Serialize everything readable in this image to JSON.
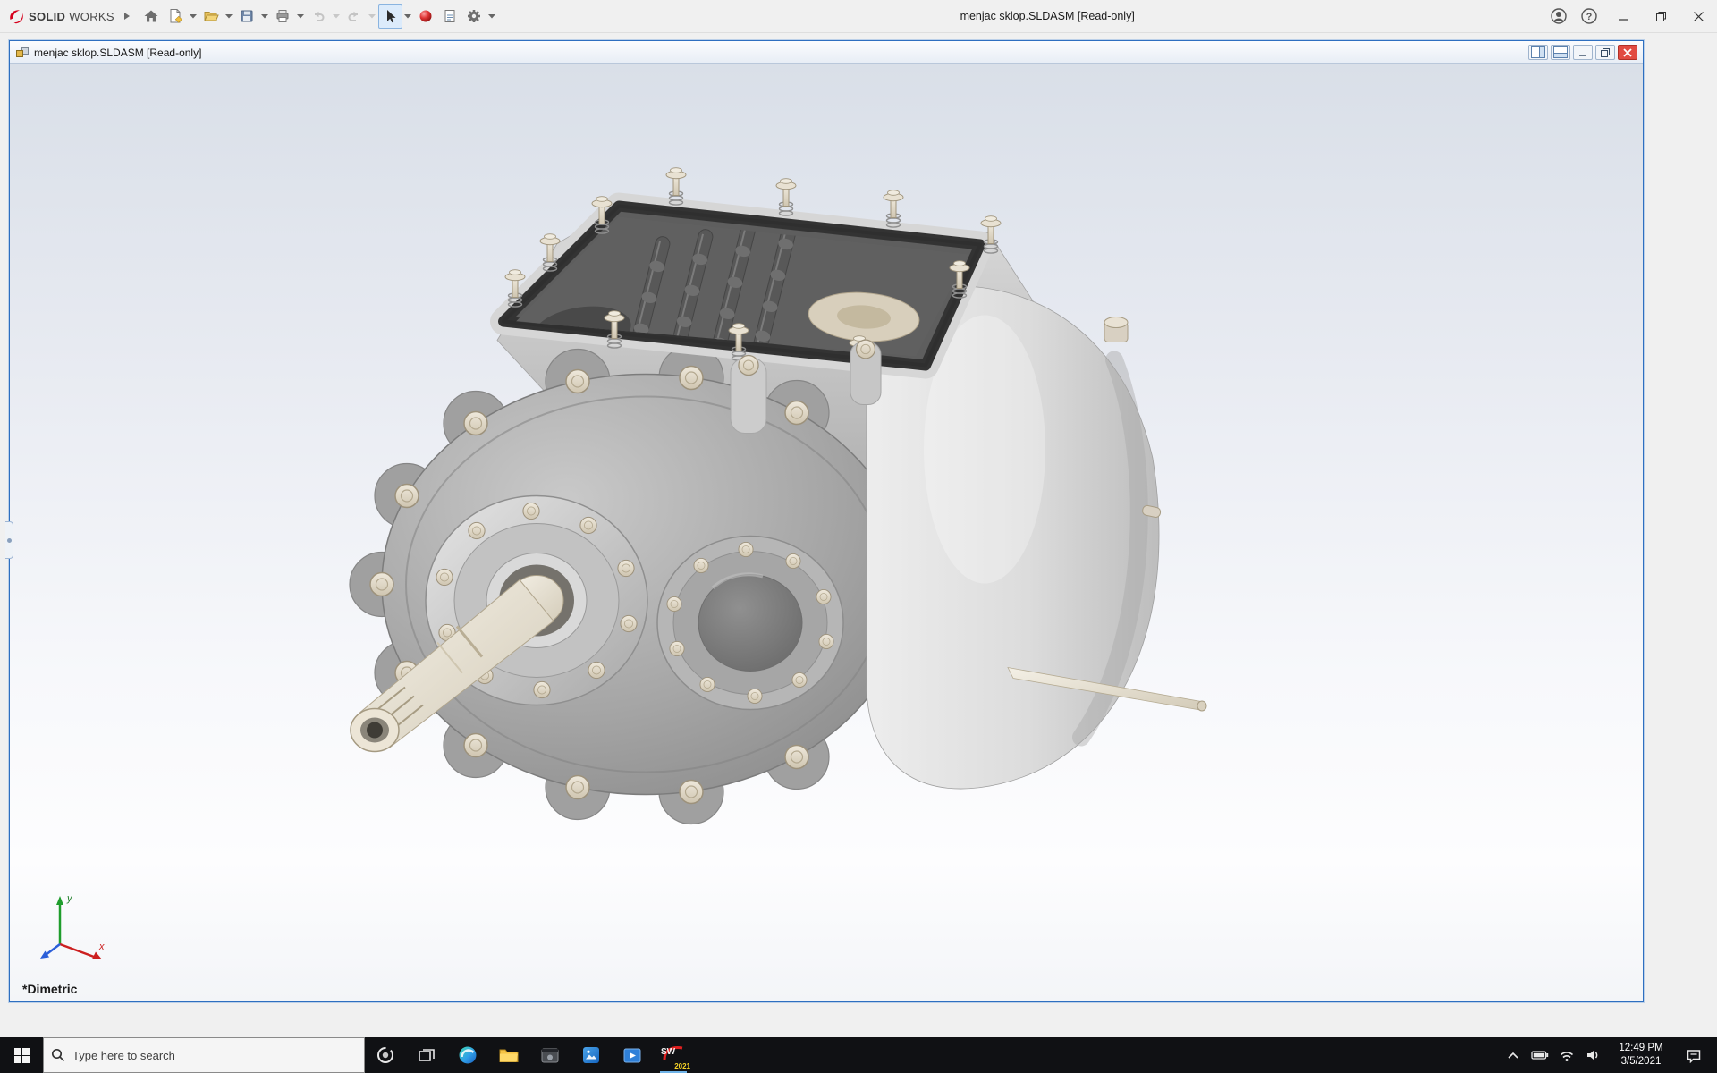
{
  "app": {
    "brand": {
      "bold": "SOLID",
      "light": "WORKS"
    },
    "window_title": "menjac sklop.SLDASM [Read-only]",
    "help_glyph": "?",
    "toolbar_icons": [
      "home",
      "new-document",
      "open",
      "save",
      "print",
      "undo",
      "redo",
      "select-arrow",
      "appearances-sphere",
      "file-properties",
      "options-gear"
    ]
  },
  "document": {
    "title": "menjac sklop.SLDASM [Read-only]",
    "view_orientation": "*Dimetric",
    "triad": {
      "x_label": "x",
      "y_label": "y"
    }
  },
  "taskbar": {
    "search_placeholder": "Type here to search",
    "clock": {
      "time": "12:49 PM",
      "date": "3/5/2021"
    },
    "solidworks_initials": "SW",
    "solidworks_year": "2021",
    "app_icons": [
      "start",
      "search",
      "cortana",
      "task-view",
      "edge",
      "file-explorer",
      "app-dark",
      "app-photos",
      "app-media",
      "solidworks"
    ]
  },
  "colors": {
    "child_window_border": "#2e6fc0",
    "viewport_gradient_top": "#d9dfe8",
    "viewport_gradient_bottom": "#fdfdfe",
    "taskbar_bg": "#101114",
    "close_button_red": "#e14b42",
    "solidworks_red": "#d6001c",
    "bolt_cream": "#d9cfc0",
    "housing_gray": "#a6a6a6"
  }
}
